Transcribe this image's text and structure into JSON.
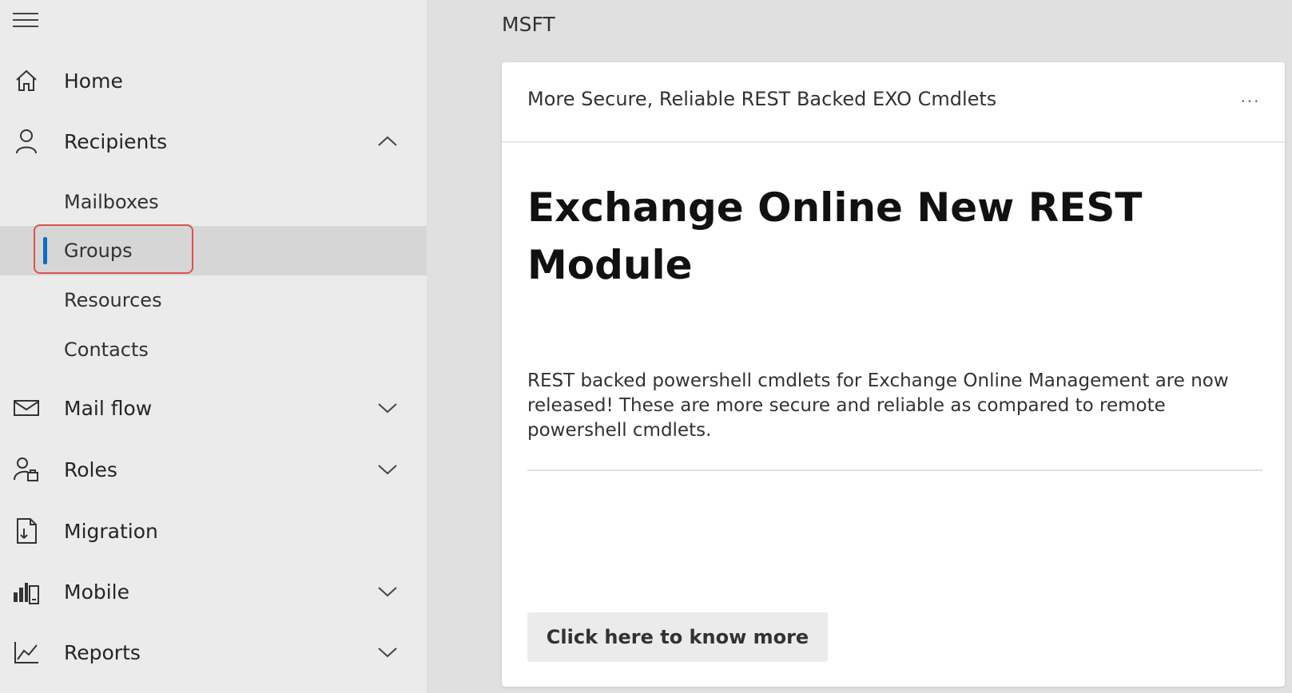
{
  "header": {
    "org_name": "MSFT"
  },
  "sidebar": {
    "menu_icon": "hamburger-icon",
    "items": [
      {
        "label": "Home",
        "icon": "home-icon"
      },
      {
        "label": "Recipients",
        "icon": "person-icon",
        "expanded": true,
        "children": [
          {
            "label": "Mailboxes"
          },
          {
            "label": "Groups",
            "selected": true
          },
          {
            "label": "Resources"
          },
          {
            "label": "Contacts"
          }
        ]
      },
      {
        "label": "Mail flow",
        "icon": "mail-icon",
        "expanded": false
      },
      {
        "label": "Roles",
        "icon": "roles-icon",
        "expanded": false
      },
      {
        "label": "Migration",
        "icon": "migration-icon"
      },
      {
        "label": "Mobile",
        "icon": "mobile-icon",
        "expanded": false
      },
      {
        "label": "Reports",
        "icon": "reports-icon",
        "expanded": false
      }
    ]
  },
  "card": {
    "header_title": "More Secure, Reliable REST Backed EXO Cmdlets",
    "more_label": "···",
    "heading": "Exchange Online New REST Module",
    "body": "REST backed powershell cmdlets for Exchange Online Management are now released! These are more secure and reliable as compared to remote powershell cmdlets.",
    "cta_label": "Click here to know more"
  },
  "colors": {
    "accent": "#0f6cbd",
    "highlight": "#d9534f",
    "sidebar_bg": "#ebebeb",
    "selected_bg": "#d6d6d6",
    "page_bg": "#e0e0e0"
  }
}
